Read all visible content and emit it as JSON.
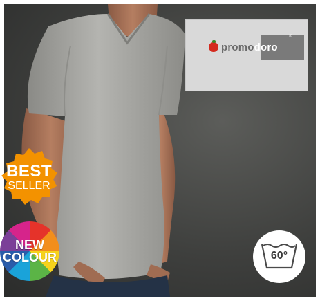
{
  "logo": {
    "part1": "promo",
    "part2": "doro",
    "registered": "®"
  },
  "badges": {
    "bestseller": {
      "line1": "BEST",
      "line2": "SELLER",
      "color": "#f39200"
    },
    "new_colour": {
      "line1": "NEW",
      "line2": "COLOUR"
    }
  },
  "care": {
    "wash_temperature": "60°",
    "icon": "wash-tub-icon"
  }
}
